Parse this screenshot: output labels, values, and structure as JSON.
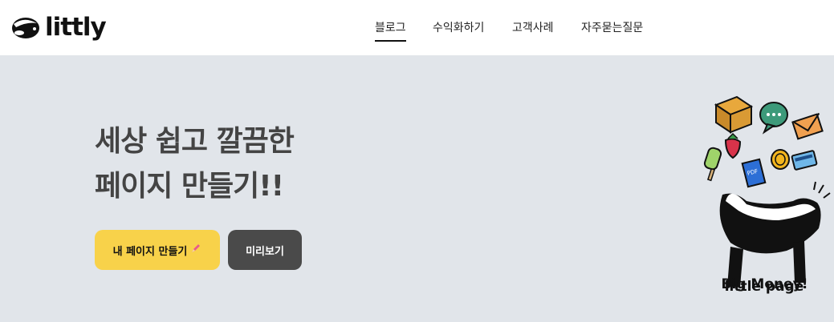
{
  "brand": {
    "name": "littly"
  },
  "nav": {
    "items": [
      {
        "label": "블로그",
        "active": true
      },
      {
        "label": "수익화하기",
        "active": false
      },
      {
        "label": "고객사례",
        "active": false
      },
      {
        "label": "자주묻는질문",
        "active": false
      }
    ]
  },
  "hero": {
    "title_line1": "세상 쉽고 깔끔한",
    "title_line2": "페이지 만들기!!",
    "primary_button": "내 페이지 만들기",
    "secondary_button": "미리보기",
    "tagline_line1": "little page",
    "tagline_line2": "Big Money!",
    "illustration_icons": [
      "box-icon",
      "chat-bubble-icon",
      "mail-icon",
      "strawberry-icon",
      "popsicle-icon",
      "pdf-icon",
      "coin-icon",
      "card-icon",
      "skunk-icon"
    ]
  },
  "colors": {
    "header_bg": "#ffffff",
    "hero_bg": "#e1e5ea",
    "primary_button": "#f8d24a",
    "secondary_button": "#4a4a4a",
    "title_text": "#444444"
  }
}
